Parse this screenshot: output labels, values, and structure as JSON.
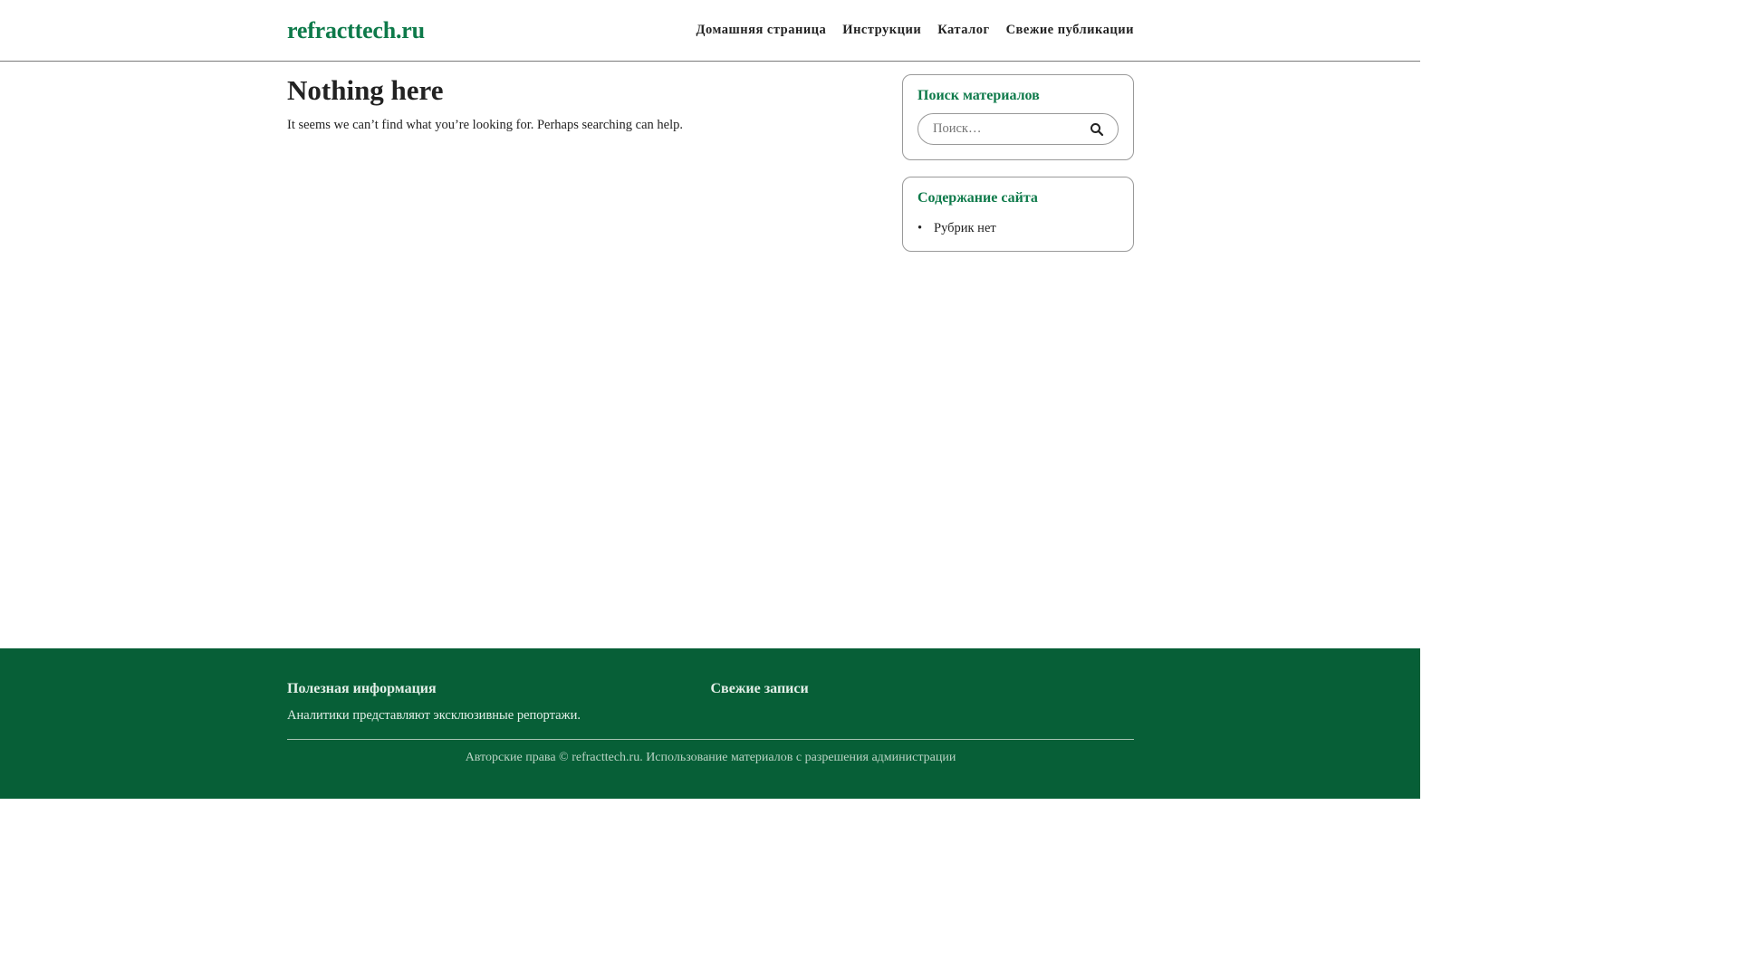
{
  "header": {
    "logo": "refracttech.ru",
    "nav": [
      "Домашняя страница",
      "Инструкции",
      "Каталог",
      "Свежие публикации"
    ]
  },
  "main": {
    "title": "Nothing here",
    "message": "It seems we can’t find what you’re looking for. Perhaps searching can help."
  },
  "sidebar": {
    "search_widget": {
      "title": "Поиск материалов",
      "placeholder": "Поиск…",
      "search_icon": "search-icon"
    },
    "categories_widget": {
      "title": "Содержание сайта",
      "items": [
        "Рубрик нет"
      ]
    }
  },
  "footer": {
    "info_title": "Полезная информация",
    "info_text": "Аналитики представляют эксклюзивные репортажи.",
    "recent_title": "Свежие записи",
    "copyright": "Авторские права © refracttech.ru. Использование материалов с разрешения администрации"
  },
  "colors": {
    "accent": "#0e7a4a",
    "footer_bg": "#075f37"
  }
}
